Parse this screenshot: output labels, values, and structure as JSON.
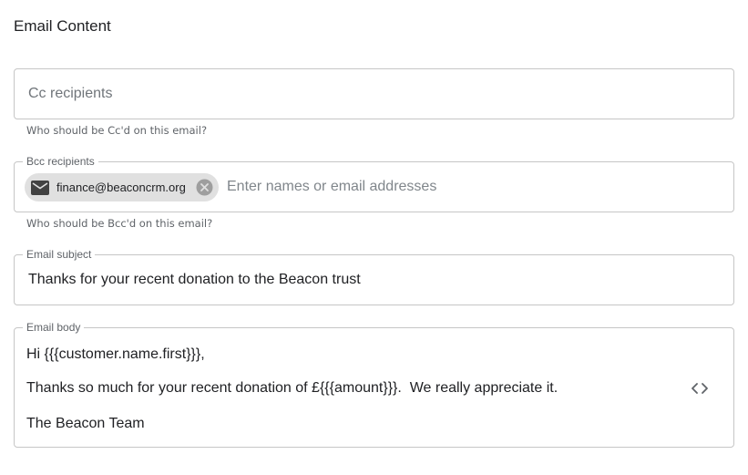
{
  "section": {
    "title": "Email Content"
  },
  "cc": {
    "placeholder": "Cc recipients",
    "value": "",
    "helper": "Who should be Cc'd on this email?"
  },
  "bcc": {
    "label": "Bcc recipients",
    "chips": [
      {
        "label": "finance@beaconcrm.org",
        "icon": "mail-icon"
      }
    ],
    "placeholder": "Enter names or email addresses",
    "value": "",
    "helper": "Who should be Bcc'd on this email?"
  },
  "subject": {
    "label": "Email subject",
    "value": "Thanks for your recent donation to the Beacon trust"
  },
  "body": {
    "label": "Email body",
    "lines": [
      "Hi {{{customer.name.first}}},",
      "Thanks so much for your recent donation of £{{{amount}}}.  We really appreciate it.",
      "The Beacon Team"
    ],
    "toggle_icon": "code-icon"
  },
  "colors": {
    "border": "#c6c6c6",
    "chip_bg": "#e0e0e0",
    "helper_text": "#5f6368",
    "text": "#202124"
  }
}
